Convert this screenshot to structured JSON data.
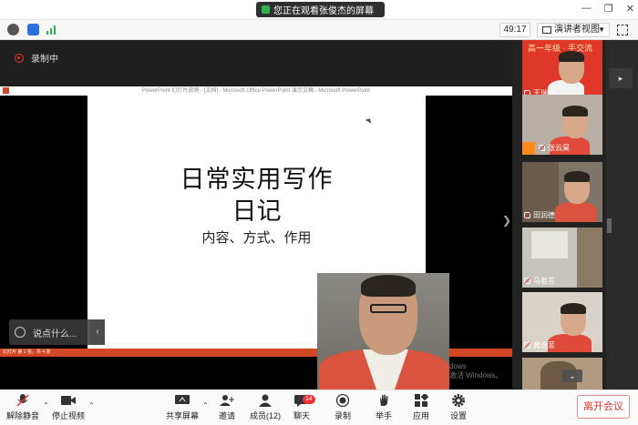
{
  "titlebar": {
    "share_status": "您正在观看张俊杰的屏幕",
    "window_controls": [
      "—",
      "❐",
      "✕"
    ]
  },
  "infobar": {
    "timer": "49:17",
    "view_mode": "演讲者视图"
  },
  "recording": {
    "label": "录制中"
  },
  "presentation": {
    "window_title": "PowerPoint 幻灯片放映 - [文档] - Microsoft Office PowerPoint 演示文稿 - Microsoft PowerPoint",
    "slide_title_line1": "日常实用写作",
    "slide_title_line2": "日记",
    "slide_subtitle": "内容、方式、作用",
    "status_bar": "幻灯片 第 1 张，共 4 张",
    "watermark_line1": "dows",
    "watermark_line2": "激活 Windows。",
    "colors": {
      "ppt_accent": "#d24726",
      "slide_bg": "#ffffff"
    }
  },
  "chat": {
    "placeholder": "说点什么..."
  },
  "participants": [
    {
      "name": "王瑞群",
      "banner": "高一年级 · 手交流",
      "muted": true
    },
    {
      "name": "张云昊",
      "muted": true,
      "host_icon": true
    },
    {
      "name": "田润德",
      "muted": true
    },
    {
      "name": "马若言",
      "muted": true
    },
    {
      "name": "黄逸菲",
      "muted": true
    },
    {
      "name": "",
      "muted": false
    }
  ],
  "toolbar": {
    "mute": "解除静音",
    "video": "停止视频",
    "share": "共享屏幕",
    "invite": "邀请",
    "members": "成员(12)",
    "chat": "聊天",
    "chat_badge": "14",
    "record": "录制",
    "raise_hand": "举手",
    "apps": "应用",
    "settings": "设置",
    "leave": "离开会议"
  }
}
